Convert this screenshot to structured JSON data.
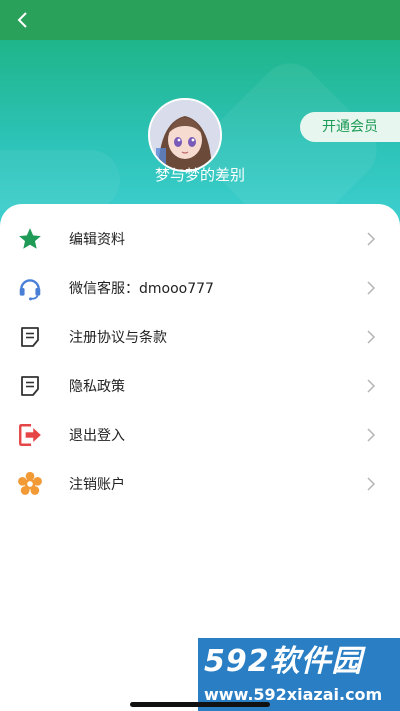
{
  "header": {
    "back_icon": "chevron-left-icon"
  },
  "profile": {
    "username": "梦与梦的差别",
    "vip_label": "开通会员",
    "avatar": "anime-girl-avatar"
  },
  "menu": [
    {
      "label": "编辑资料",
      "icon": "star-icon",
      "color": "#1f9b57"
    },
    {
      "label": "微信客服：dmooo777",
      "icon": "headset-icon",
      "color": "#4a7fd6"
    },
    {
      "label": "注册协议与条款",
      "icon": "document-icon",
      "color": "#333333"
    },
    {
      "label": "隐私政策",
      "icon": "document-icon",
      "color": "#333333"
    },
    {
      "label": "退出登入",
      "icon": "logout-icon",
      "color": "#e64545"
    },
    {
      "label": "注销账户",
      "icon": "flower-icon",
      "color": "#f29a36"
    }
  ],
  "watermark": {
    "brand": "592软件园",
    "url": "www.592xiazai.com"
  },
  "colors": {
    "top_bar": "#2aa15a",
    "hero_gradient": [
      "#1fb58a",
      "#3fd0d1"
    ],
    "accent": "#1d9a55"
  }
}
